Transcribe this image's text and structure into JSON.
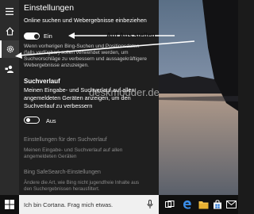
{
  "window": {
    "title": "Einstellungen"
  },
  "settings": {
    "online_search": {
      "heading": "Online suchen und Webergebnisse einbeziehen",
      "toggle_state": "Ein",
      "description": [
        "Wenn vorherigen Bing-Suchen und Positionsdaten",
        "(falls verfügbar) sollen verwendet werden, um",
        "Suchvorschläge zu verbessern und aussagekräftigere",
        "Webergebnisse anzuzeigen."
      ]
    },
    "search_history": {
      "heading": "Suchverlauf",
      "description": [
        "Meinen Eingabe- und Suchverlauf auf allen",
        "angemeldeten Geräten anzeigen, um den",
        "Suchverlauf zu verbessern"
      ],
      "toggle_state": "Aus"
    },
    "history_settings": {
      "link": "Einstellungen für den Suchverlauf",
      "description": [
        "Meinen Eingabe- und Suchverlauf auf allen",
        "angemeldeten Geräten"
      ]
    },
    "safesearch": {
      "link": "Bing SafeSearch-Einstellungen",
      "description": [
        "Ändere die Art, wie Bing nicht jugendfreie Inhalte aus",
        "den Suchergebnissen herausfiltert."
      ]
    }
  },
  "annotation": {
    "label": "Auf Aus stellen"
  },
  "watermark": "deskmodder.de",
  "taskbar": {
    "search_placeholder": "Ich bin Cortana. Frag mich etwas."
  },
  "icons": [
    "menu-icon",
    "home-icon",
    "gear-icon",
    "feedback-icon",
    "windows-start-icon",
    "microphone-icon",
    "task-view-icon",
    "edge-icon",
    "file-explorer-icon",
    "store-icon",
    "mail-icon"
  ],
  "colors": {
    "panel_bg": "#1f1f1f",
    "rail_bg": "#2b2b2b",
    "taskbar_bg": "#101010",
    "text": "#ffffff",
    "muted_text": "#8a8a8a",
    "search_box_bg": "#f0f0f0"
  }
}
